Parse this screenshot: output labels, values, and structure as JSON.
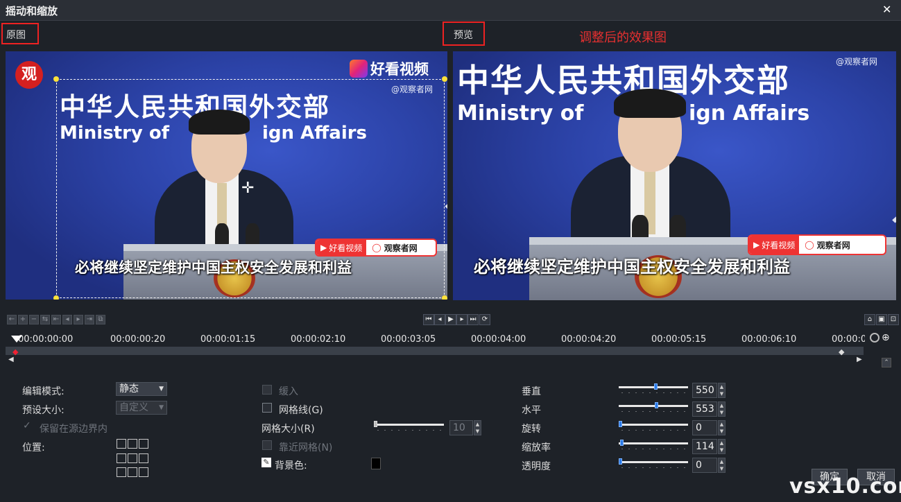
{
  "window": {
    "title": "摇动和缩放",
    "close_glyph": "✕"
  },
  "labels": {
    "original": "原图",
    "preview": "预览",
    "annotation": "调整后的效果图"
  },
  "video": {
    "sign_cn": "中华人民共和国外交部",
    "sign_en_left": "Ministry of",
    "sign_en_right": "ign Affairs",
    "subtitle": "必将继续坚定维护中国主权安全发展和利益",
    "logo_text": "好看视频",
    "watermark": "@观察者网",
    "badge_left": "好看视频",
    "badge_right": "观察者网",
    "corner_logo": "观"
  },
  "timeline": {
    "ticks": [
      "00:00:00:00",
      "00:00:00:20",
      "00:00:01:15",
      "00:00:02:10",
      "00:00:03:05",
      "00:00:04:00",
      "00:00:04:20",
      "00:00:05:15",
      "00:00:06:10",
      "00:00:0"
    ]
  },
  "controls": {
    "edit_mode_label": "编辑模式:",
    "edit_mode_value": "静态",
    "preset_size_label": "预设大小:",
    "preset_size_value": "自定义",
    "keep_in_bounds_label": "保留在源边界内",
    "position_label": "位置:",
    "ease_in_label": "缓入",
    "grid_lines_label": "网格线(G)",
    "grid_size_label": "网格大小(R)",
    "grid_size_value": "10",
    "snap_grid_label": "靠近网格(N)",
    "bg_color_label": "背景色:",
    "bg_color": "#000000",
    "vertical_label": "垂直",
    "vertical_value": "550",
    "horizontal_label": "水平",
    "horizontal_value": "553",
    "rotate_label": "旋转",
    "rotate_value": "0",
    "zoom_label": "缩放率",
    "zoom_value": "114",
    "opacity_label": "透明度",
    "opacity_value": "0",
    "ok_label": "确定",
    "cancel_label": "取消"
  },
  "site_watermark": "vsx10.com",
  "colors": {
    "accent_red": "#e22222",
    "slider_knob": "#2a7ae8",
    "bg": "#1e2228"
  }
}
